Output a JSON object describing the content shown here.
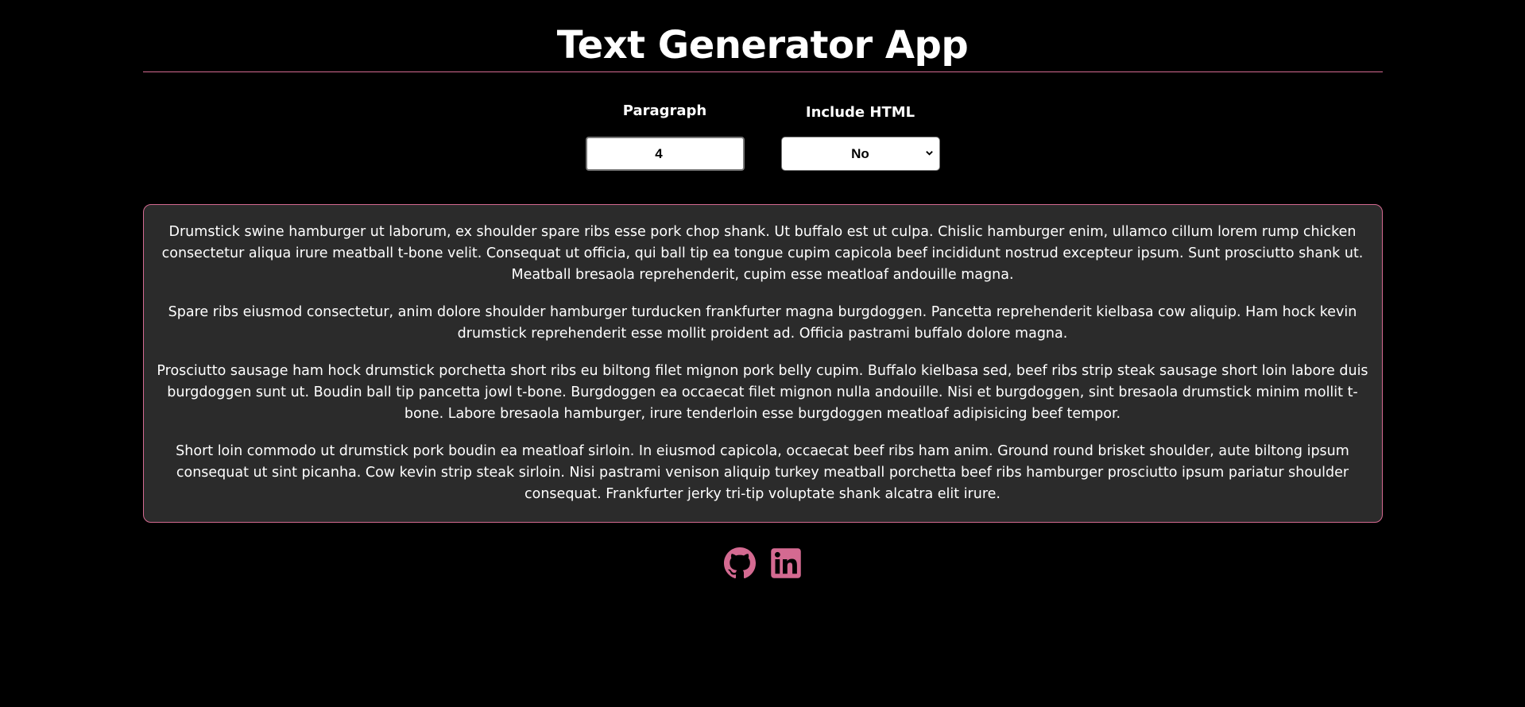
{
  "header": {
    "title": "Text Generator App"
  },
  "controls": {
    "paragraph_label": "Paragraph",
    "paragraph_value": "4",
    "html_label": "Include HTML",
    "html_selected": "No"
  },
  "content": {
    "paragraphs": [
      "Drumstick swine hamburger ut laborum, ex shoulder spare ribs esse pork chop shank. Ut buffalo est ut culpa. Chislic hamburger enim, ullamco cillum lorem rump chicken consectetur aliqua irure meatball t-bone velit. Consequat ut officia, qui ball tip ea tongue cupim capicola beef incididunt nostrud excepteur ipsum. Sunt prosciutto shank ut. Meatball bresaola reprehenderit, cupim esse meatloaf andouille magna.",
      "Spare ribs eiusmod consectetur, anim dolore shoulder hamburger turducken frankfurter magna burgdoggen. Pancetta reprehenderit kielbasa cow aliquip. Ham hock kevin drumstick reprehenderit esse mollit proident ad. Officia pastrami buffalo dolore magna.",
      "Prosciutto sausage ham hock drumstick porchetta short ribs eu biltong filet mignon pork belly cupim. Buffalo kielbasa sed, beef ribs strip steak sausage short loin labore duis burgdoggen sunt ut. Boudin ball tip pancetta jowl t-bone. Burgdoggen ea occaecat filet mignon nulla andouille. Nisi et burgdoggen, sint bresaola drumstick minim mollit t-bone. Labore bresaola hamburger, irure tenderloin esse burgdoggen meatloaf adipisicing beef tempor.",
      "Short loin commodo ut drumstick pork boudin ea meatloaf sirloin. In eiusmod capicola, occaecat beef ribs ham anim. Ground round brisket shoulder, aute biltong ipsum consequat ut sint picanha. Cow kevin strip steak sirloin. Nisi pastrami venison aliquip turkey meatball porchetta beef ribs hamburger prosciutto ipsum pariatur shoulder consequat. Frankfurter jerky tri-tip voluptate shank alcatra elit irure."
    ]
  },
  "footer": {
    "icons": [
      "github-icon",
      "linkedin-icon"
    ]
  },
  "colors": {
    "background": "#000000",
    "accent": "#d46a91",
    "panel": "#2b2b2b",
    "text": "#ffffff"
  }
}
